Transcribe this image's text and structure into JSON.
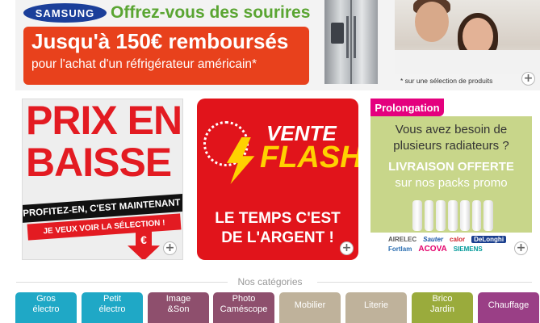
{
  "top_banner": {
    "brand_logo": "SAMSUNG",
    "headline": "Offrez-vous des sourires",
    "offer_amount": "Jusqu'à 150€ remboursés",
    "offer_detail": "pour l'achat d'un réfrigérateur américain*",
    "footnote": "* sur une sélection de produits"
  },
  "promos": {
    "prix_en_baisse": {
      "title_line1": "PRIX EN",
      "title_line2": "BAISSE",
      "banner1": "PROFITEZ-EN, C'EST MAINTENANT",
      "banner2": "JE VEUX VOIR LA SÉLECTION !",
      "symbol": "€"
    },
    "vente_flash": {
      "word1": "VENTE",
      "word2": "FLASH",
      "slogan_line1": "LE TEMPS C'EST",
      "slogan_line2": "DE L'ARGENT !"
    },
    "radiateurs": {
      "tag": "Prolongation",
      "question_line1": "Vous avez besoin de",
      "question_line2": "plusieurs radiateurs ?",
      "offer_line1": "LIVRAISON OFFERTE",
      "offer_line2": "sur nos packs promo",
      "brands": [
        "AIRELEC",
        "Sauter",
        "calor",
        "DeLonghi",
        "Fortlam",
        "ACOVA",
        "SIEMENS"
      ]
    }
  },
  "plus_icon": "+",
  "categories": {
    "title": "Nos catégories",
    "items": [
      {
        "line1": "Gros",
        "line2": "électro",
        "color": "#1fa8c6"
      },
      {
        "line1": "Petit",
        "line2": "électro",
        "color": "#1fa8c6"
      },
      {
        "line1": "Image",
        "line2": "&Son",
        "color": "#8e4f6d"
      },
      {
        "line1": "Photo",
        "line2": "Caméscope",
        "color": "#8e4f6d"
      },
      {
        "line1": "Mobilier",
        "line2": "",
        "color": "#bfb29b"
      },
      {
        "line1": "Literie",
        "line2": "",
        "color": "#bfb29b"
      },
      {
        "line1": "Brico",
        "line2": "Jardin",
        "color": "#9aab3c"
      },
      {
        "line1": "Chauffage",
        "line2": "",
        "color": "#9a3f86"
      }
    ]
  }
}
